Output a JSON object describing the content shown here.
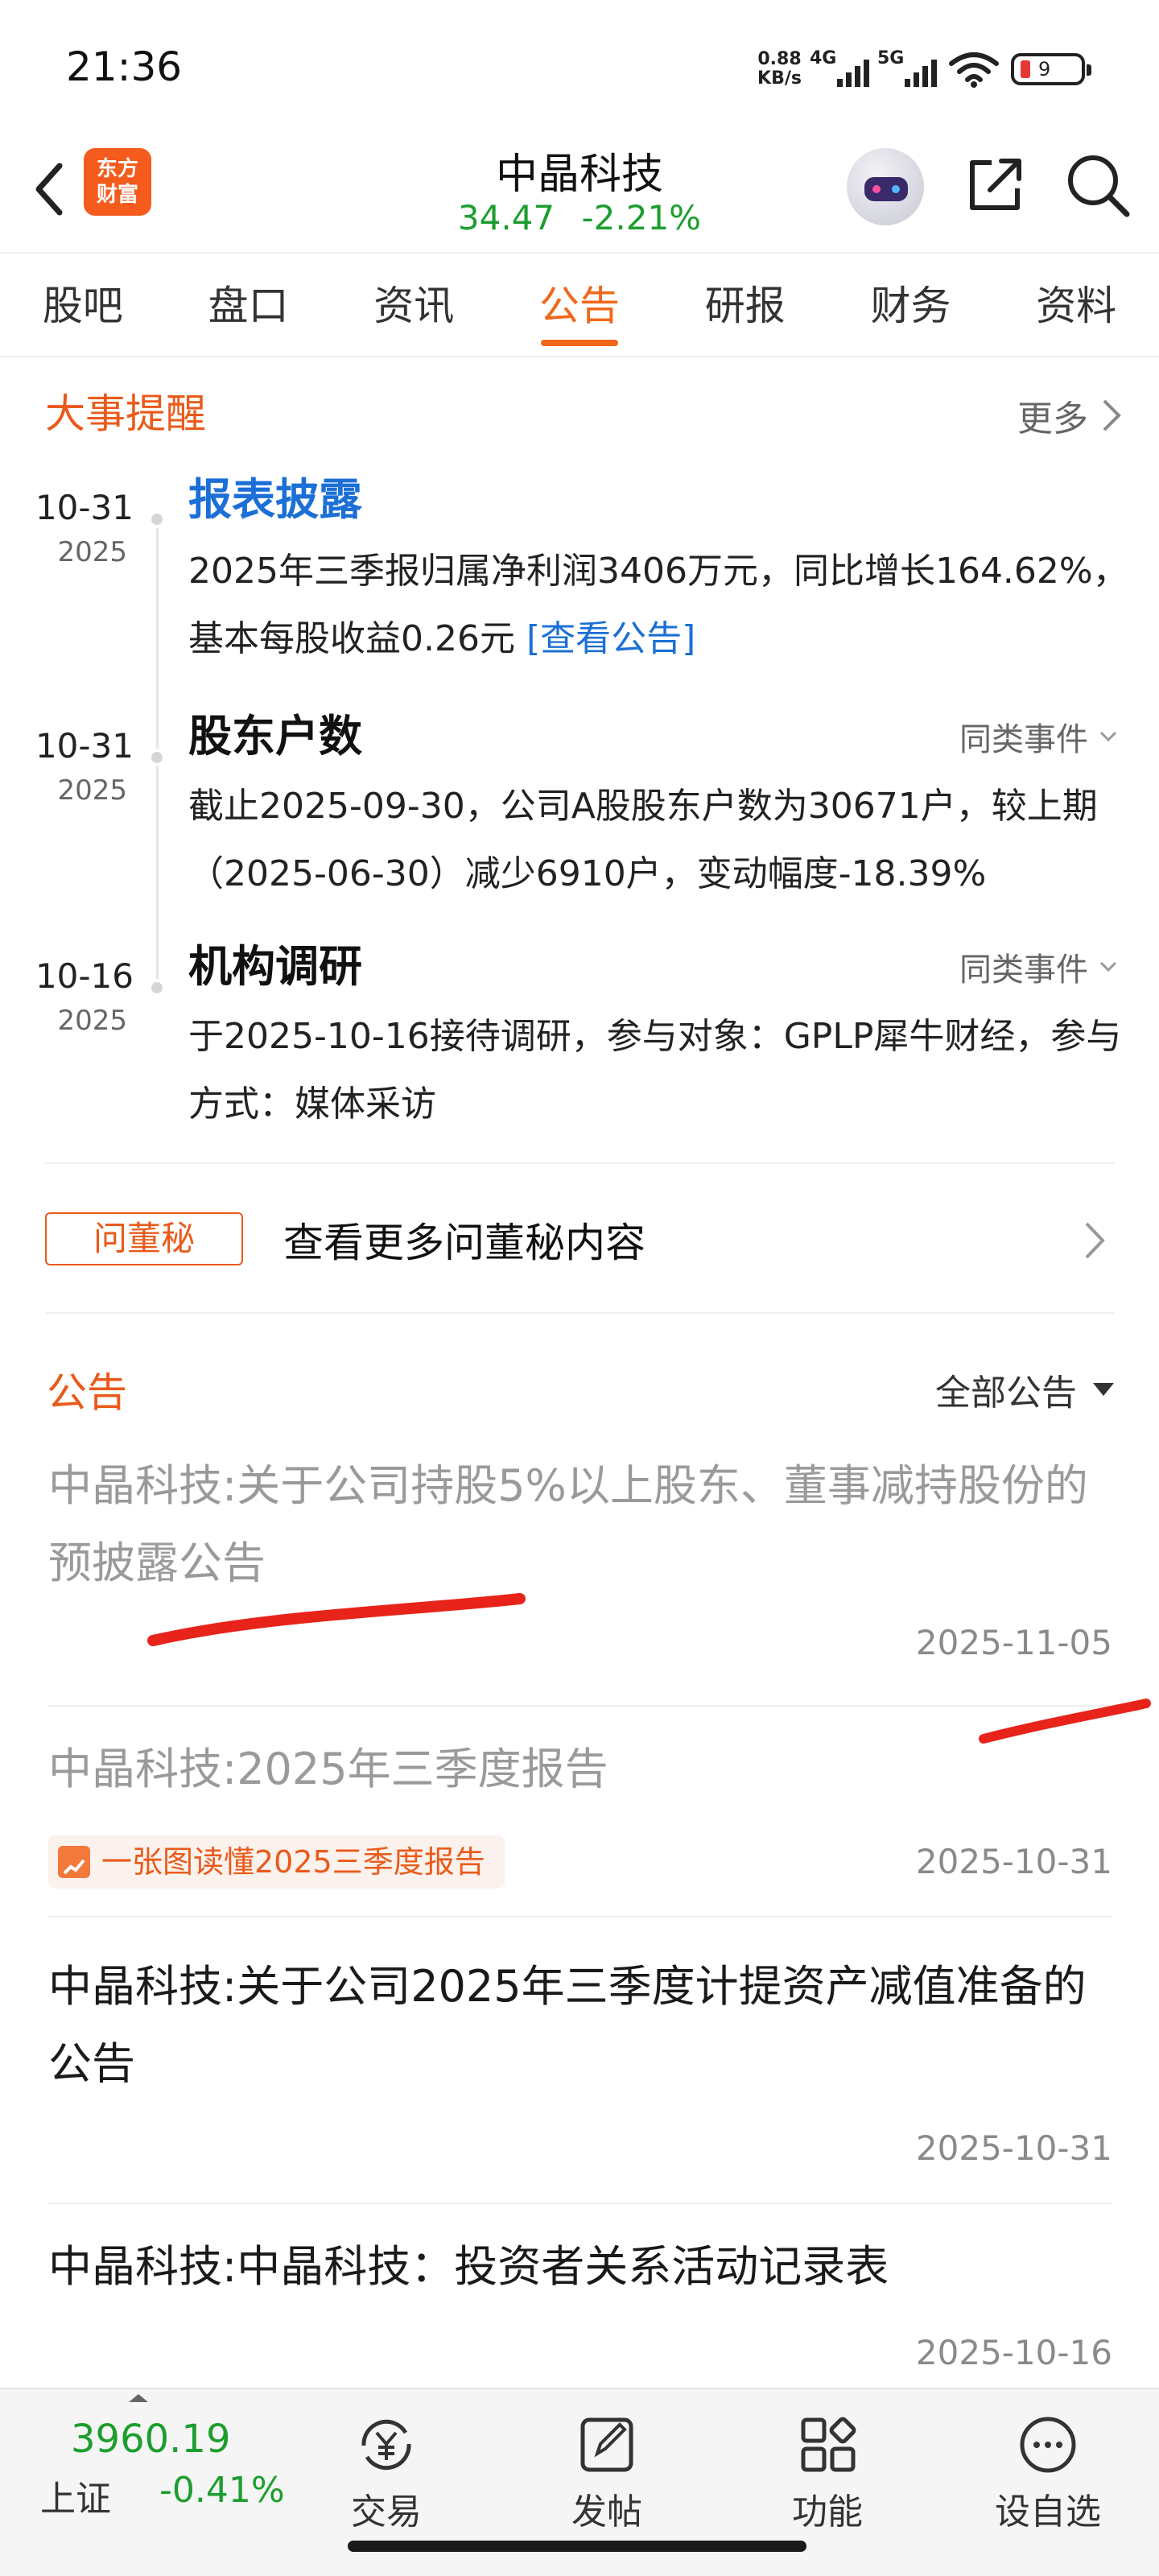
{
  "status_bar": {
    "time": "21:36",
    "net_speed_value": "0.88",
    "net_speed_unit": "KB/s",
    "sim1": "4G",
    "sim2": "5G",
    "battery": "9"
  },
  "header": {
    "logo_line1": "东方",
    "logo_line2": "财富",
    "stock_name": "中晶科技",
    "price": "34.47",
    "change_pct": "-2.21%"
  },
  "tabs": [
    {
      "label": "股吧",
      "active": false
    },
    {
      "label": "盘口",
      "active": false
    },
    {
      "label": "资讯",
      "active": false
    },
    {
      "label": "公告",
      "active": true
    },
    {
      "label": "研报",
      "active": false
    },
    {
      "label": "财务",
      "active": false
    },
    {
      "label": "资料",
      "active": false
    }
  ],
  "events": {
    "title": "大事提醒",
    "more": "更多",
    "items": [
      {
        "date": "10-31",
        "year": "2025",
        "title": "报表披露",
        "body": "2025年三季报归属净利润3406万元，同比增长164.62%，基本每股收益0.26元",
        "link": "[查看公告]"
      },
      {
        "date": "10-31",
        "year": "2025",
        "title": "股东户数",
        "same": "同类事件",
        "body": "截止2025-09-30，公司A股股东户数为30671户，较上期（2025-06-30）减少6910户，变动幅度-18.39%"
      },
      {
        "date": "10-16",
        "year": "2025",
        "title": "机构调研",
        "same": "同类事件",
        "body": "于2025-10-16接待调研，参与对象：GPLP犀牛财经，参与方式：媒体采访"
      }
    ]
  },
  "qa": {
    "badge": "问董秘",
    "text": "查看更多问董秘内容"
  },
  "announcements": {
    "title": "公告",
    "filter": "全部公告",
    "items": [
      {
        "text": "中晶科技:关于公司持股5%以上股东、董事减持股份的预披露公告",
        "date": "2025-11-05",
        "read": true
      },
      {
        "text": "中晶科技:2025年三季度报告",
        "date": "2025-10-31",
        "read": true,
        "tag": "一张图读懂2025三季度报告"
      },
      {
        "text": "中晶科技:关于公司2025年三季度计提资产减值准备的公告",
        "date": "2025-10-31",
        "read": false
      },
      {
        "text": "中晶科技:中晶科技：投资者关系活动记录表",
        "date": "2025-10-16",
        "read": false
      }
    ]
  },
  "bottom_bar": {
    "index_value": "3960.19",
    "index_name": "上证",
    "index_change": "-0.41%",
    "tabs": [
      {
        "label": "交易",
        "icon": "trade-icon"
      },
      {
        "label": "发帖",
        "icon": "post-icon"
      },
      {
        "label": "功能",
        "icon": "grid-icon"
      },
      {
        "label": "设自选",
        "icon": "more-icon"
      }
    ]
  },
  "colors": {
    "accent": "#ea5a1a",
    "down_green": "#1c9e2e",
    "link_blue": "#1b6fd6",
    "annotation_red": "#e8231a"
  }
}
